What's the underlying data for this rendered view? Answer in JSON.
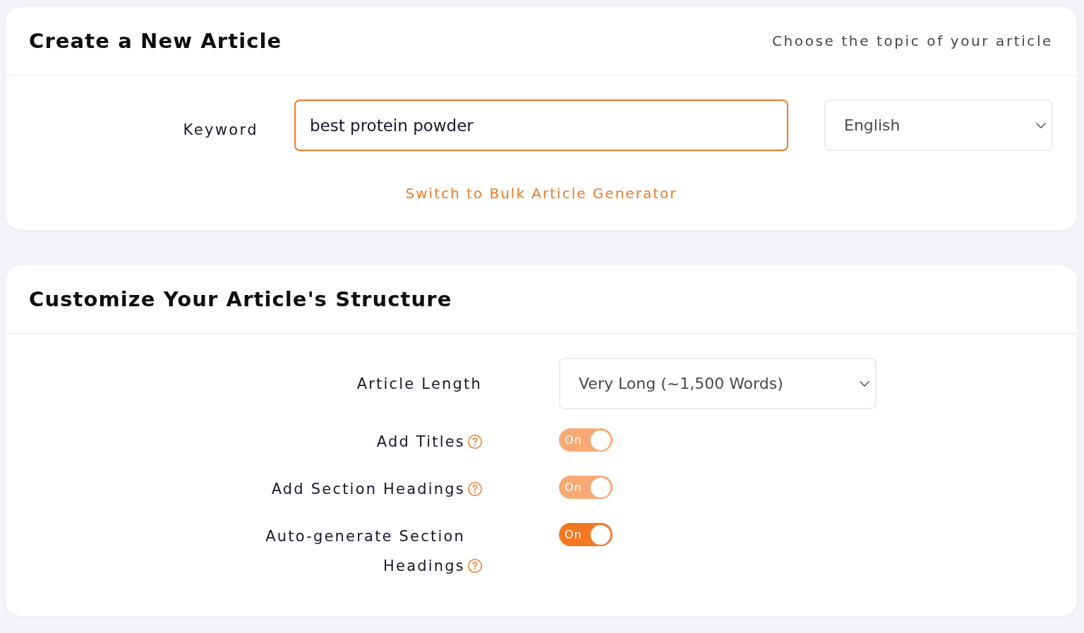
{
  "create_card": {
    "title": "Create a New Article",
    "subtitle": "Choose the topic of your article",
    "keyword": {
      "label": "Keyword",
      "value": "best protein powder",
      "focused": true
    },
    "language": {
      "value": "English"
    },
    "switch_link": "Switch to Bulk Article Generator"
  },
  "structure_card": {
    "title": "Customize Your Article's Structure",
    "rows": [
      {
        "kind": "select",
        "label": "Article Length",
        "value": "Very Long (~1,500 Words)"
      },
      {
        "kind": "toggle",
        "label": "Add Titles",
        "help": true,
        "on": true,
        "disabled": true,
        "text": "On"
      },
      {
        "kind": "toggle",
        "label": "Add Section Headings",
        "help": true,
        "on": true,
        "disabled": true,
        "text": "On"
      },
      {
        "kind": "toggle",
        "label": "Auto-generate Section Headings",
        "help": true,
        "on": true,
        "disabled": false,
        "text": "On"
      }
    ]
  }
}
